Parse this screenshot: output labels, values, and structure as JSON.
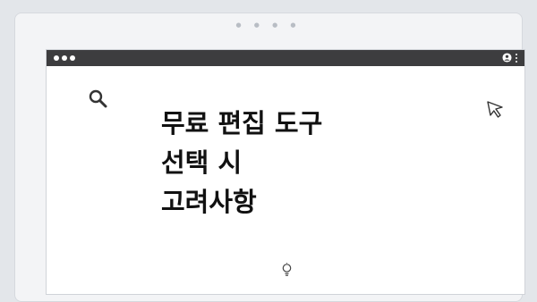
{
  "pagination": {
    "dots_glyph": "● ● ● ●"
  },
  "browser": {
    "title_bar_color": "#3d3d3f",
    "window_controls": [
      "dot",
      "dot",
      "dot"
    ],
    "icons": [
      "user-icon",
      "more-vertical-icon"
    ]
  },
  "content": {
    "headline_lines": [
      "무료 편집 도구",
      "선택 시",
      "고려사항"
    ],
    "left_icon": "search-icon",
    "right_icon": "cursor-icon",
    "bottom_icon": "lightbulb-icon"
  }
}
